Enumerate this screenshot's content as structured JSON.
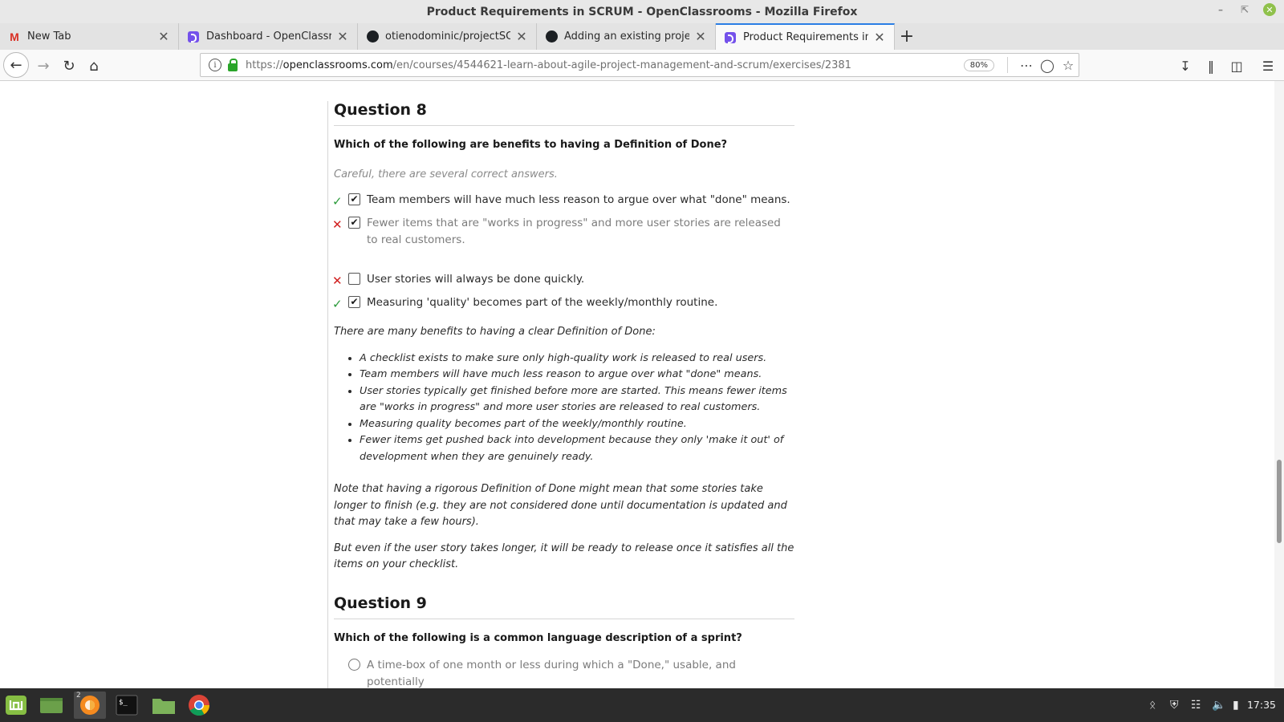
{
  "window": {
    "title": "Product Requirements in SCRUM - OpenClassrooms - Mozilla Firefox"
  },
  "tabs": [
    {
      "label": "New Tab",
      "icon": "gmail-icon",
      "active": false
    },
    {
      "label": "Dashboard - OpenClassrooms",
      "icon": "openclassrooms-icon",
      "active": false
    },
    {
      "label": "otienodominic/projectSCRUM",
      "icon": "github-icon",
      "active": false
    },
    {
      "label": "Adding an existing project to GitHub",
      "icon": "github-icon",
      "active": false
    },
    {
      "label": "Product Requirements in SCRUM",
      "icon": "openclassrooms-icon",
      "active": true
    }
  ],
  "nav": {
    "url_prefix": "https://",
    "url_host": "openclassrooms.com",
    "url_path": "/en/courses/4544621-learn-about-agile-project-management-and-scrum/exercises/2381",
    "zoom": "80%"
  },
  "question8": {
    "title": "Question 8",
    "text": "Which of the following are benefits to having a Definition of Done?",
    "hint": "Careful, there are several correct answers.",
    "answers": [
      {
        "text": "Team members will have much less reason to argue over what \"done\" means.",
        "mark": "correct",
        "checked": true
      },
      {
        "text": "Fewer items that are \"works in progress\" and more user stories are released to real customers.",
        "mark": "wrong",
        "checked": true
      },
      {
        "text": "User stories will always be done quickly.",
        "mark": "wrong",
        "checked": false
      },
      {
        "text": "Measuring 'quality' becomes part of the weekly/monthly routine.",
        "mark": "correct",
        "checked": true
      }
    ],
    "explanation_intro": "There are many benefits to having a clear Definition of Done:",
    "explanation_items": [
      "A checklist exists to make sure only high-quality work is released to real users.",
      "Team members will have much less reason to argue over what \"done\" means.",
      "User stories typically get finished before more are started. This means fewer items are \"works in progress\" and more user stories are released to real customers.",
      "Measuring quality becomes part of the weekly/monthly routine.",
      "Fewer items get pushed back into development because they only 'make it out' of development when they are genuinely ready."
    ],
    "note": "Note that having a rigorous Definition of Done might mean that some stories take longer to finish (e.g. they are not considered done until documentation is updated and that may take a few hours).",
    "closing": "But even if the user story takes longer, it will be ready to release once it satisfies all the items on your checklist."
  },
  "question9": {
    "title": "Question 9",
    "text": "Which of the following is a common language description of a sprint?",
    "first_option": "A time-box of one month or less during which a \"Done,\" usable, and potentially"
  },
  "taskbar": {
    "firefox_badge": "2",
    "clock": "17:35"
  },
  "colors": {
    "correct": "#2a9a3a",
    "wrong": "#d12020",
    "accent": "#2a7ee5"
  }
}
